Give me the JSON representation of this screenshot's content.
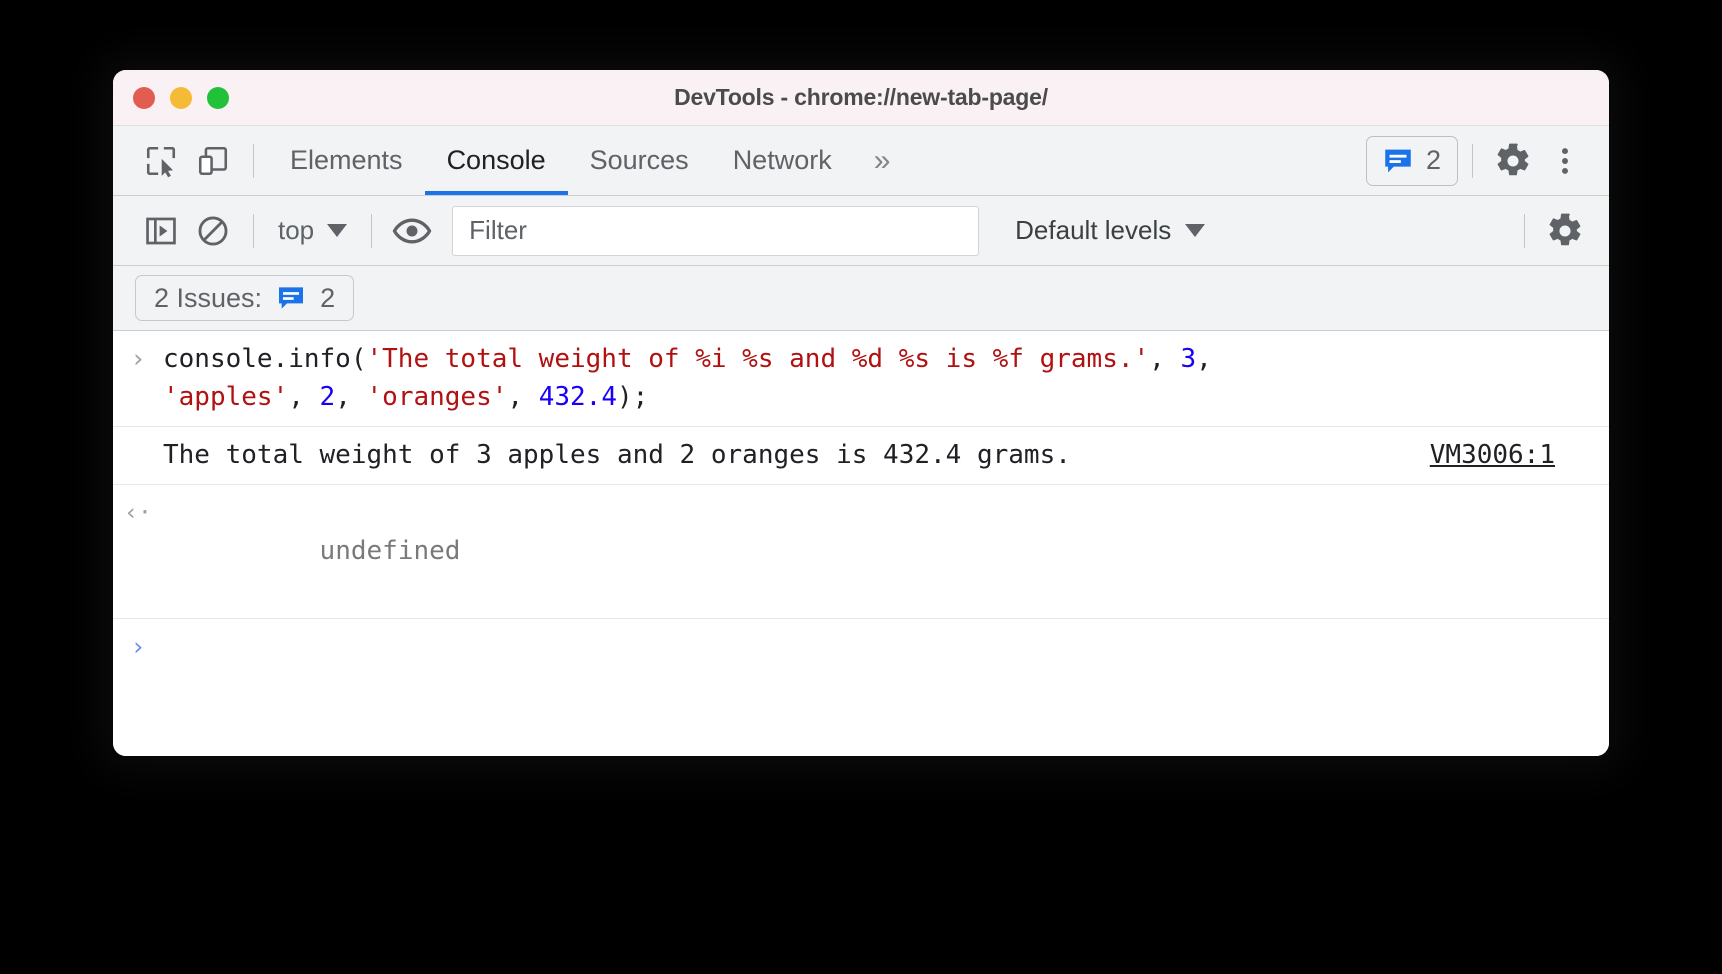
{
  "window": {
    "title": "DevTools - chrome://new-tab-page/",
    "traffic_lights": [
      {
        "name": "close",
        "color": "#e35c50"
      },
      {
        "name": "minimize",
        "color": "#f5bb37"
      },
      {
        "name": "maximize",
        "color": "#21c23a"
      }
    ]
  },
  "tabbar": {
    "inspect_icon": "inspect-element-icon",
    "device_icon": "device-toolbar-icon",
    "tabs": [
      {
        "label": "Elements",
        "active": false
      },
      {
        "label": "Console",
        "active": true
      },
      {
        "label": "Sources",
        "active": false
      },
      {
        "label": "Network",
        "active": false
      }
    ],
    "more_tabs": "»",
    "issues_count": "2",
    "settings_icon": "gear-icon",
    "more_icon": "kebab-menu-icon"
  },
  "console_toolbar": {
    "sidebar_toggle_icon": "console-sidebar-icon",
    "clear_icon": "clear-console-icon",
    "context": "top",
    "eye_icon": "live-expression-icon",
    "filter_value": "",
    "filter_placeholder": "Filter",
    "levels": "Default levels",
    "settings_icon": "console-settings-gear-icon"
  },
  "issues_bar": {
    "label": "2 Issues:",
    "count": "2",
    "icon": "issues-speech-bubble-icon"
  },
  "console": {
    "prompt_marker": "›",
    "result_marker": "‹·",
    "input_line1_prefix": "console.info(",
    "input_line1_string": "'The total weight of %i %s and %d %s is %f grams.'",
    "input_line1_comma": ", ",
    "input_line1_num": "3",
    "input_line1_tail": ",",
    "input_line2_str1": "'apples'",
    "input_line2_sep1": ", ",
    "input_line2_num1": "2",
    "input_line2_sep2": ", ",
    "input_line2_str2": "'oranges'",
    "input_line2_sep3": ", ",
    "input_line2_num2": "432.4",
    "input_line2_tail": ");",
    "output_text": "The total weight of 3 apples and 2 oranges is 432.4 grams.",
    "output_source": "VM3006:1",
    "result_value": "undefined"
  },
  "colors": {
    "accent_blue": "#1a73e8",
    "string_red": "#b11111",
    "number_blue": "#1a00f7",
    "toolbar_bg": "#f1f3f4",
    "titlebar_bg": "#faf1f4"
  }
}
